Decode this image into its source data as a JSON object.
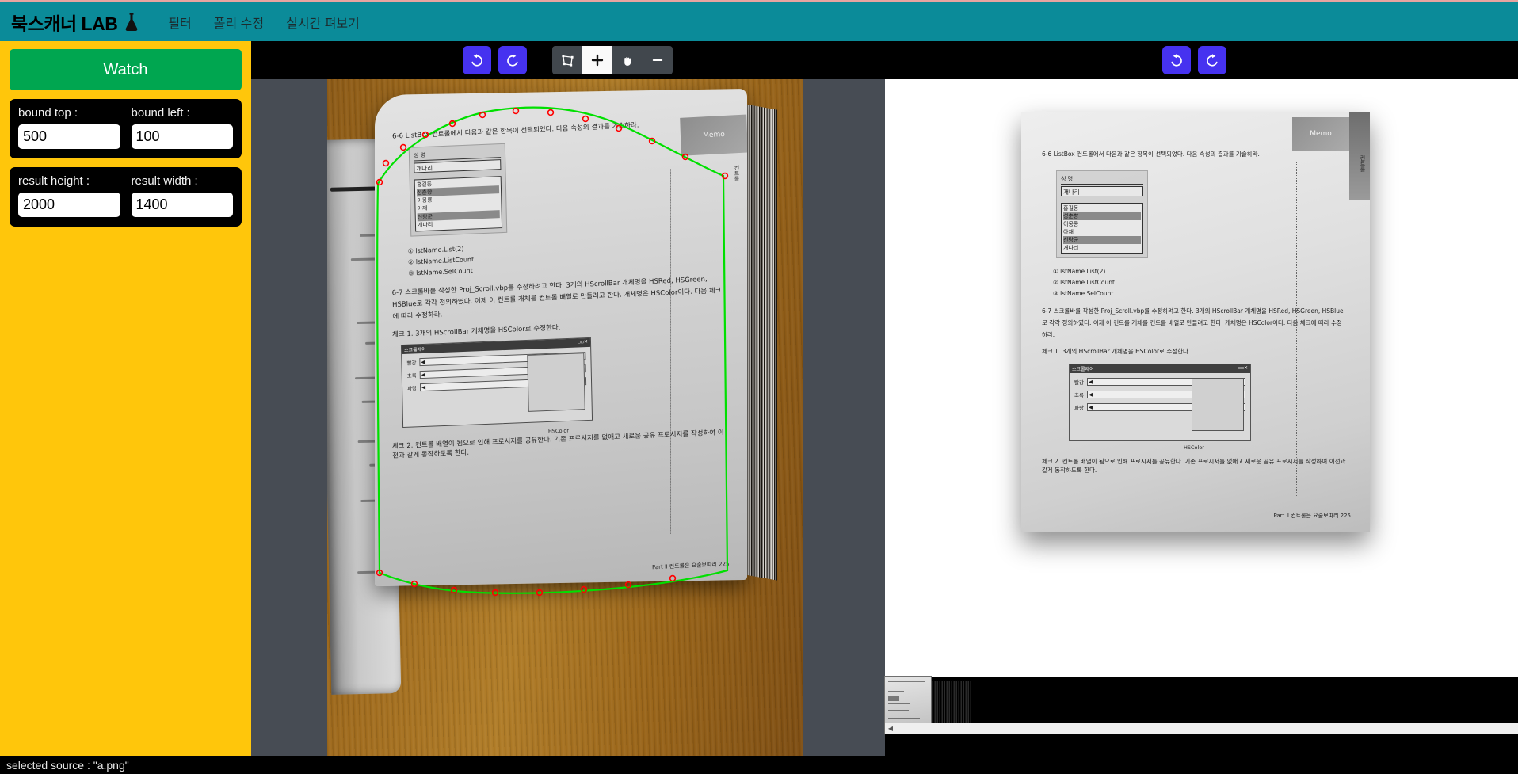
{
  "app": {
    "brand": "북스캐너 LAB",
    "brand_icon": "flask-icon",
    "nav": [
      {
        "label": "필터",
        "name": "nav-filter"
      },
      {
        "label": "폴리 수정",
        "name": "nav-poly-edit"
      },
      {
        "label": "실시간 펴보기",
        "name": "nav-realtime-unfold"
      }
    ],
    "colors": {
      "navbar": "#0b8b99",
      "navbar_top_accent": "#e8a4a0",
      "sidebar": "#ffc60b",
      "watch_button": "#00a650",
      "toolbar_button": "#4632f0",
      "segment_bg": "#41474d",
      "segment_active": "#fafafa",
      "viewer_backdrop": "#474c54",
      "outline": "#00e000",
      "handle": "#ff0000"
    }
  },
  "sidebar": {
    "watch_label": "Watch",
    "fields": [
      {
        "label": "bound top :",
        "value": "500",
        "name": "bound-top-input"
      },
      {
        "label": "bound left :",
        "value": "100",
        "name": "bound-left-input"
      },
      {
        "label": "result height :",
        "value": "2000",
        "name": "result-height-input"
      },
      {
        "label": "result width :",
        "value": "1400",
        "name": "result-width-input"
      }
    ]
  },
  "source_toolbar": {
    "undo": {
      "icon": "undo-icon",
      "glyph": "↺"
    },
    "redo": {
      "icon": "redo-icon",
      "glyph": "↻"
    },
    "tools": [
      {
        "icon": "crop-polygon-icon",
        "name": "tool-crop-polygon",
        "active": false
      },
      {
        "icon": "plus-icon",
        "name": "tool-zoom-in",
        "active": true
      },
      {
        "icon": "hand-icon",
        "name": "tool-pan",
        "active": false
      },
      {
        "icon": "minus-icon",
        "name": "tool-zoom-out",
        "active": false
      }
    ]
  },
  "result_toolbar": {
    "undo": {
      "icon": "undo-icon",
      "glyph": "↺"
    },
    "redo": {
      "icon": "redo-icon",
      "glyph": "↻"
    }
  },
  "source_page": {
    "question_6_6": "6-6 ListBox 컨트롤에서 다음과 같은 항목이 선택되었다. 다음 속성의 결과를 기술하라.",
    "dialog_label": "성 명",
    "dialog_value": "개나리",
    "list_items": [
      "홍길동",
      "성춘향",
      "이몽룡",
      "아재",
      "신랑군",
      "개나리"
    ],
    "items": [
      "① lstName.List(2)",
      "② lstName.ListCount",
      "③ lstName.SelCount"
    ],
    "question_6_7": "6-7 스크롤바를 작성한 Proj_Scroll.vbp를 수정하려고 한다. 3개의 HScrollBar 개체명을 HSRed, HSGreen, HSBlue로 각각 정의하였다. 이제 이 컨트롤 개체를 컨트롤 배열로 만들려고 한다. 개체명은 HSColor이다. 다음 체크에 따라 수정하라.",
    "check_1": "체크 1. 3개의 HScrollBar 개체명을 HSColor로 수정한다.",
    "fig_title": "스크롤제어",
    "fig_rows": [
      "빨강",
      "초록",
      "파랑"
    ],
    "fig_caption": "HSColor",
    "check_2": "체크 2. 컨트롤 배열이 됨으로 인해 프로시저를 공유한다. 기존 프로시저를 없애고 새로운 공유 프로시저를 작성하여 이전과 같게 동작하도록 한다.",
    "memo": "Memo",
    "tab_text": "컨트롤",
    "footer_part": "Part Ⅱ  컨트롤은 요술보따리",
    "footer_page": "225"
  },
  "result_page": {
    "question_6_6": "6-6 ListBox 컨트롤에서 다음과 같은 항목이 선택되었다. 다음 속성의 결과를 기술하라.",
    "dialog_label": "성 명",
    "dialog_value": "개나리",
    "list_items": [
      "홍길동",
      "성춘향",
      "이몽룡",
      "아재",
      "신랑군",
      "개나리"
    ],
    "items": [
      "① lstName.List(2)",
      "② lstName.ListCount",
      "③ lstName.SelCount"
    ],
    "question_6_7": "6-7 스크롤바를 작성한 Proj_Scroll.vbp를 수정하려고 한다. 3개의 HScrollBar 개체명을 HSRed, HSGreen, HSBlue로 각각 정의하였다. 이제 이 컨트롤 개체를 컨트롤 배열로 만들려고 한다. 개체명은 HSColor이다. 다음 체크에 따라 수정하라.",
    "check_1": "체크 1. 3개의 HScrollBar 개체명을 HSColor로 수정한다.",
    "fig_title": "스크롤제어",
    "fig_rows": [
      "빨강",
      "초록",
      "파랑"
    ],
    "fig_caption": "HSColor",
    "check_2": "체크 2. 컨트롤 배열이 됨으로 인해 프로시저를 공유한다. 기존 프로시저를 없애고 새로운 공유 프로시저를 작성하여 이전과 같게 동작하도록 한다.",
    "memo": "Memo",
    "tab_text": "컨트롤",
    "footer_part": "Part Ⅱ  컨트롤은 요술보따리",
    "footer_page": "225"
  },
  "thumbnails": {
    "scroll_left_glyph": "◀",
    "items": [
      {
        "name": "thumbnail-page-scan",
        "selected": true
      },
      {
        "name": "thumbnail-page-edges",
        "selected": false
      }
    ]
  },
  "statusbar": {
    "text": "selected source : \"a.png\""
  }
}
